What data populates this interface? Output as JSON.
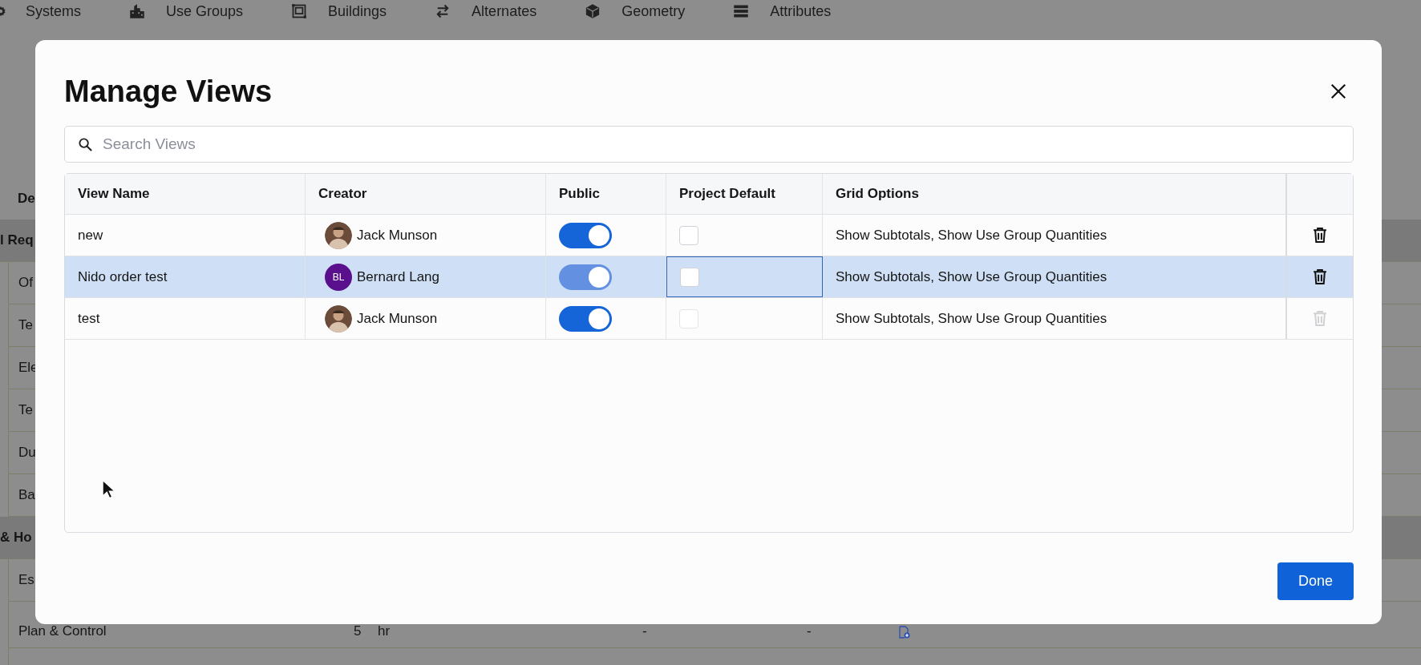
{
  "nav_tabs": [
    {
      "label": "Systems"
    },
    {
      "label": "Use Groups"
    },
    {
      "label": "Buildings"
    },
    {
      "label": "Alternates"
    },
    {
      "label": "Geometry"
    },
    {
      "label": "Attributes"
    }
  ],
  "background_rows": [
    {
      "kind": "header",
      "label": "De"
    },
    {
      "kind": "section",
      "label": "l Req"
    },
    {
      "kind": "item",
      "label": "Of"
    },
    {
      "kind": "item",
      "label": "Te"
    },
    {
      "kind": "item",
      "label": "Ele"
    },
    {
      "kind": "item",
      "label": "Te"
    },
    {
      "kind": "item",
      "label": "Du"
    },
    {
      "kind": "item",
      "label": "Ba"
    },
    {
      "kind": "section",
      "label": "& Ho"
    },
    {
      "kind": "item",
      "label": "Es"
    },
    {
      "kind": "item",
      "label": "Plan & Control",
      "cells": [
        "5",
        "hr",
        "-",
        "-"
      ]
    }
  ],
  "dialog": {
    "title": "Manage Views",
    "search": {
      "placeholder": "Search Views"
    },
    "columns": [
      "View Name",
      "Creator",
      "Public",
      "Project Default",
      "Grid Options"
    ],
    "rows": [
      {
        "name": "new",
        "creator": {
          "name": "Jack Munson",
          "kind": "photo"
        },
        "public": true,
        "project_default": false,
        "focused": false,
        "grid_options": "Show Subtotals, Show Use Group Quantities",
        "selected": false,
        "delete_disabled": false
      },
      {
        "name": "Nido order test",
        "creator": {
          "name": "Bernard Lang",
          "kind": "initials",
          "initials": "BL"
        },
        "public": true,
        "project_default": false,
        "focused": true,
        "grid_options": "Show Subtotals, Show Use Group Quantities",
        "selected": true,
        "delete_disabled": false
      },
      {
        "name": "test",
        "creator": {
          "name": "Jack Munson",
          "kind": "photo"
        },
        "public": true,
        "project_default": false,
        "focused": false,
        "grid_options": "Show Subtotals, Show Use Group Quantities",
        "selected": false,
        "delete_disabled": true
      }
    ],
    "done_button": "Done"
  }
}
